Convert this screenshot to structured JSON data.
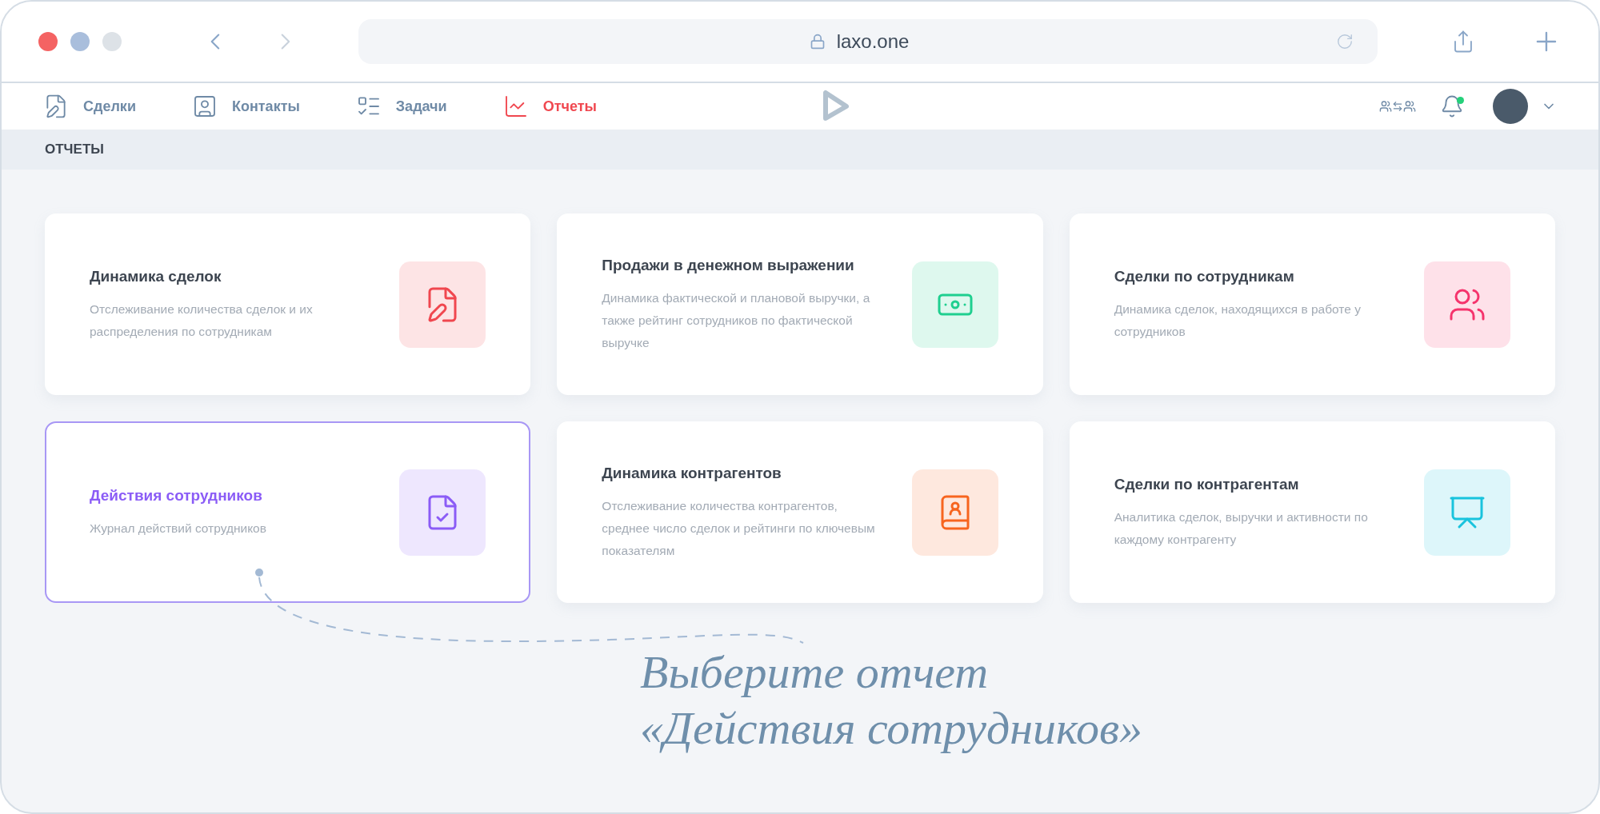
{
  "browser": {
    "url": "laxo.one"
  },
  "nav": [
    {
      "kind": "deals",
      "label": "Сделки",
      "selected": false
    },
    {
      "kind": "contacts",
      "label": "Контакты",
      "selected": false
    },
    {
      "kind": "tasks",
      "label": "Задачи",
      "selected": false
    },
    {
      "kind": "reports",
      "label": "Отчеты",
      "selected": true
    }
  ],
  "header": {
    "bell_unread": true
  },
  "breadcrumb": "ОТЧЕТЫ",
  "cards": [
    {
      "kind": "deals",
      "title": "Динамика сделок",
      "description": "Отслеживание количества сделок и их распределения по сотрудникам",
      "color": "#f0474f",
      "selected": false
    },
    {
      "kind": "money",
      "title": "Продажи в денежном выражении",
      "description": "Динамика фактической и плановой выручки, а также рейтинг сотрудников по фактической выручке",
      "color": "#1fcf8f",
      "selected": false
    },
    {
      "kind": "team",
      "title": "Сделки по сотрудникам",
      "description": "Динамика сделок, находящихся в работе у сотрудников",
      "color": "#f5336c",
      "selected": false
    },
    {
      "kind": "log",
      "title": "Действия сотрудников",
      "description": "Журнал действий сотрудников",
      "color": "#8b5cf6",
      "selected": true
    },
    {
      "kind": "contacts",
      "title": "Динамика контрагентов",
      "description": "Отслеживание количества контрагентов, среднее число сделок и рейтинги по ключевым показателям",
      "color": "#f7651f",
      "selected": false
    },
    {
      "kind": "clients",
      "title": "Сделки по контрагентам",
      "description": "Аналитика сделок, выручки и активности по каждому контрагенту",
      "color": "#19c3dd",
      "selected": false
    }
  ],
  "annotation": [
    "Выберите отчет",
    "«Действия сотрудников»"
  ]
}
